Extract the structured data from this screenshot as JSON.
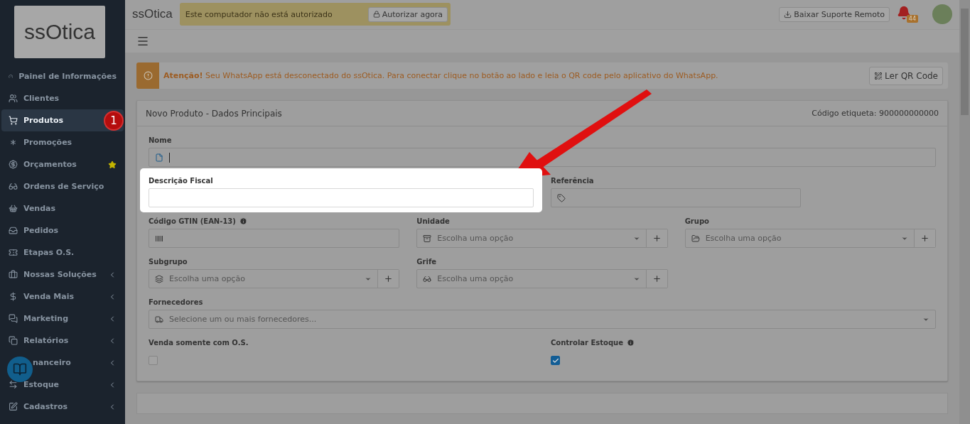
{
  "sidebar": {
    "logo": "ssOtica",
    "items": [
      {
        "label": "Painel de Informações",
        "selected": false,
        "expandable": false
      },
      {
        "label": "Clientes",
        "selected": false,
        "expandable": false
      },
      {
        "label": "Produtos",
        "selected": true,
        "expandable": false,
        "step_badge": "1"
      },
      {
        "label": "Promoções",
        "selected": false,
        "expandable": false
      },
      {
        "label": "Orçamentos",
        "selected": false,
        "expandable": false,
        "starred": true
      },
      {
        "label": "Ordens de Serviço",
        "selected": false,
        "expandable": false
      },
      {
        "label": "Vendas",
        "selected": false,
        "expandable": false
      },
      {
        "label": "Pedidos",
        "selected": false,
        "expandable": false
      },
      {
        "label": "Etapas O.S.",
        "selected": false,
        "expandable": false
      },
      {
        "label": "Nossas Soluções",
        "selected": false,
        "expandable": true
      },
      {
        "label": "Venda Mais",
        "selected": false,
        "expandable": true
      },
      {
        "label": "Marketing",
        "selected": false,
        "expandable": true
      },
      {
        "label": "Relatórios",
        "selected": false,
        "expandable": true
      },
      {
        "label": "nanceiro",
        "selected": false,
        "expandable": true
      },
      {
        "label": "Estoque",
        "selected": false,
        "expandable": true
      },
      {
        "label": "Cadastros",
        "selected": false,
        "expandable": true
      }
    ]
  },
  "topbar": {
    "logo": "ssOtica",
    "notice": "Este computador não está autorizado",
    "notice_button": "Autorizar agora",
    "support_button": "Baixar Suporte Remoto",
    "notifications": "44"
  },
  "alert": {
    "text": "**Atenção!** Seu WhatsApp está desconectado do ssOtica. Para conectar clique no botão ao lado e leia o QR code pelo aplicativo do WhatsApp.",
    "button": "Ler QR Code"
  },
  "card": {
    "title": "Novo Produto - Dados Principais",
    "code": "Código etiqueta: 900000000000",
    "rows": [
      {
        "fields": [
          {
            "kind": "input",
            "label": "Nome",
            "focused": true,
            "highlighted": false
          }
        ]
      },
      {
        "fields": [
          {
            "kind": "input",
            "label": "Descrição Fiscal",
            "focused": false,
            "highlighted": true
          },
          {
            "kind": "input",
            "label": "Referência",
            "focused": false,
            "highlighted": false
          }
        ]
      },
      {
        "fields": [
          {
            "kind": "input",
            "label": "Código GTIN (EAN-13)",
            "info": true,
            "focused": false,
            "highlighted": false
          },
          {
            "kind": "select",
            "label": "Unidade",
            "placeholder": "Escolha uma opção",
            "addable": true
          },
          {
            "kind": "select",
            "label": "Grupo",
            "placeholder": "Escolha uma opção",
            "addable": true
          }
        ]
      },
      {
        "fields": [
          {
            "kind": "select",
            "label": "Subgrupo",
            "placeholder": "Escolha uma opção",
            "addable": true
          },
          {
            "kind": "select",
            "label": "Grife",
            "placeholder": "Escolha uma opção",
            "addable": true
          }
        ]
      },
      {
        "fields": [
          {
            "kind": "select",
            "label": "Fornecedores",
            "placeholder": "Selecione um ou mais fornecedores...",
            "addable": false
          }
        ]
      },
      {
        "fields": [
          {
            "kind": "checkbox",
            "label": "Venda somente com O.S.",
            "checked": false
          },
          {
            "kind": "checkbox",
            "label": "Controlar Estoque",
            "info": true,
            "checked": true
          }
        ]
      }
    ]
  }
}
